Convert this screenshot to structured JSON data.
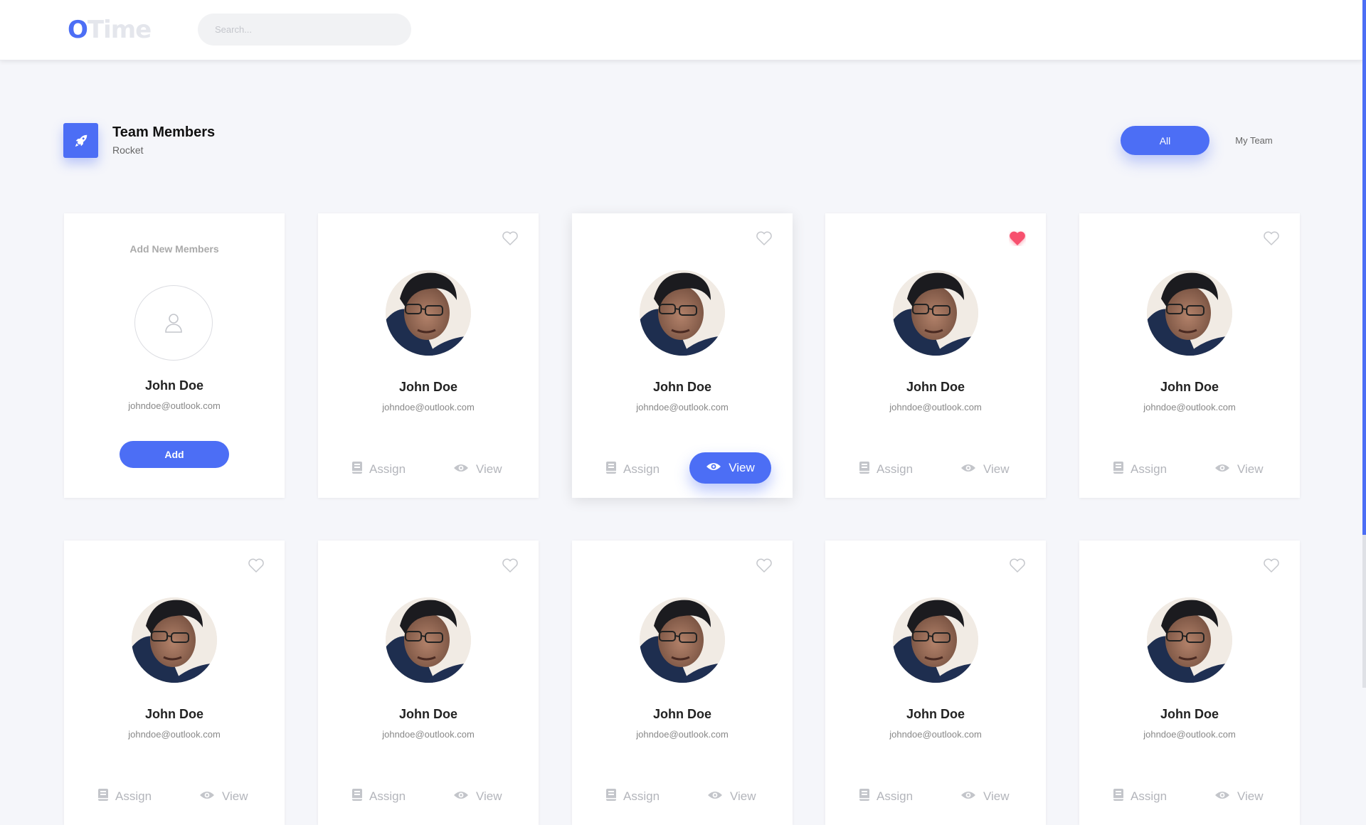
{
  "app": {
    "logo_first": "O",
    "logo_rest": "Time",
    "search_placeholder": "Search..."
  },
  "colors": {
    "accent": "#4c6ef5",
    "heart_active": "#f7506e",
    "background": "#f5f6fa"
  },
  "section": {
    "icon": "rocket-icon",
    "title": "Team Members",
    "subtitle": "Rocket"
  },
  "filters": {
    "all": "All",
    "my_team": "My Team",
    "selected": "All"
  },
  "add_card": {
    "title": "Add New Members",
    "icon": "user-icon",
    "name": "John Doe",
    "email": "johndoe@outlook.com",
    "button": "Add"
  },
  "actions": {
    "assign": "Assign",
    "view": "View"
  },
  "members": [
    {
      "name": "John Doe",
      "email": "johndoe@outlook.com",
      "favorite": false,
      "view_active": false
    },
    {
      "name": "John Doe",
      "email": "johndoe@outlook.com",
      "favorite": false,
      "view_active": true
    },
    {
      "name": "John Doe",
      "email": "johndoe@outlook.com",
      "favorite": true,
      "view_active": false
    },
    {
      "name": "John Doe",
      "email": "johndoe@outlook.com",
      "favorite": false,
      "view_active": false
    },
    {
      "name": "John Doe",
      "email": "johndoe@outlook.com",
      "favorite": false,
      "view_active": false
    },
    {
      "name": "John Doe",
      "email": "johndoe@outlook.com",
      "favorite": false,
      "view_active": false
    },
    {
      "name": "John Doe",
      "email": "johndoe@outlook.com",
      "favorite": false,
      "view_active": false
    },
    {
      "name": "John Doe",
      "email": "johndoe@outlook.com",
      "favorite": false,
      "view_active": false
    },
    {
      "name": "John Doe",
      "email": "johndoe@outlook.com",
      "favorite": false,
      "view_active": false
    }
  ]
}
